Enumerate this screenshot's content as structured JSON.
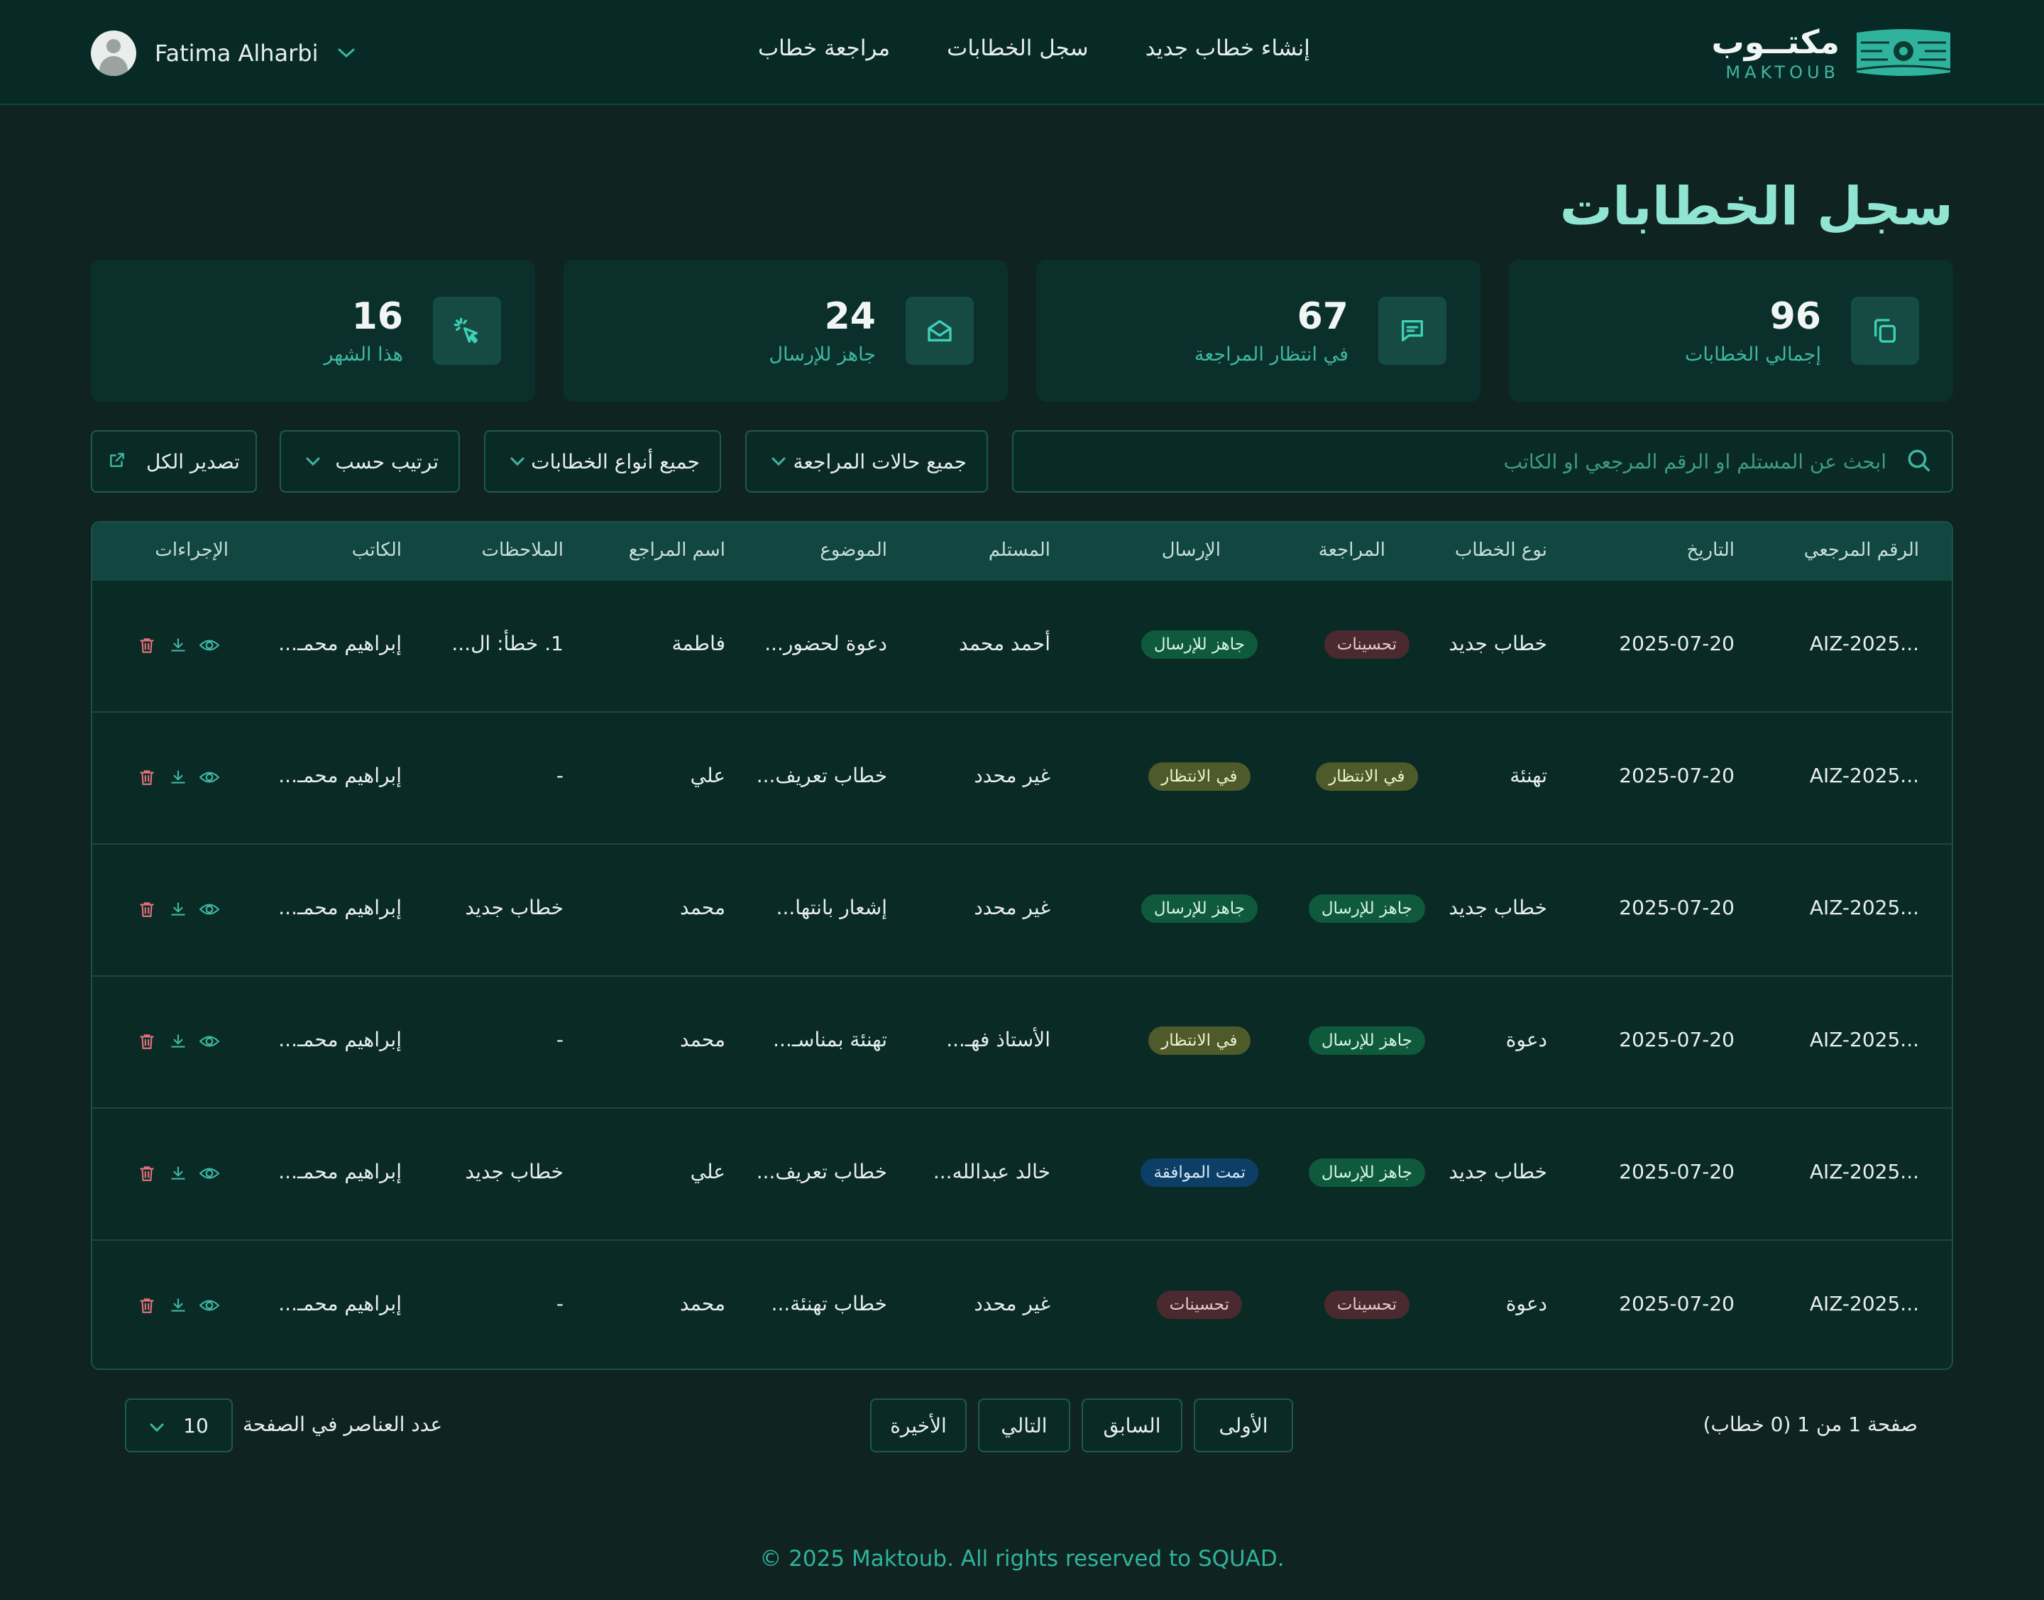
{
  "header": {
    "user_name": "Fatima Alharbi",
    "nav": [
      "إنشاء خطاب جديد",
      "سجل الخطابات",
      "مراجعة خطاب"
    ],
    "logo_ar": "مكتــوب",
    "logo_en": "MAKTOUB"
  },
  "page_title": "سجل الخطابات",
  "stats": [
    {
      "value": "96",
      "label": "إجمالي الخطابات",
      "icon": "copy-icon"
    },
    {
      "value": "67",
      "label": "في انتظار المراجعة",
      "icon": "message-icon"
    },
    {
      "value": "24",
      "label": "جاهز للإرسال",
      "icon": "mail-open-icon"
    },
    {
      "value": "16",
      "label": "هذا الشهر",
      "icon": "click-icon"
    }
  ],
  "filters": {
    "search_placeholder": "ابحث عن المستلم او الرقم المرجعي او الكاتب",
    "review_status": "جميع حالات المراجعة",
    "letter_types": "جميع أنواع الخطابات",
    "sort_by": "ترتيب حسب",
    "export_all": "تصدير الكل"
  },
  "table": {
    "headers": [
      "الرقم المرجعي",
      "التاريخ",
      "نوع الخطاب",
      "المراجعة",
      "الإرسال",
      "المستلم",
      "الموضوع",
      "اسم المراجع",
      "الملاحظات",
      "الكاتب",
      "الإجراءات"
    ],
    "rows": [
      {
        "ref": "AIZ-2025...",
        "date": "2025-07-20",
        "type": "خطاب جديد",
        "review": "تحسينات",
        "send": "جاهز للإرسال",
        "recipient": "أحمد محمد",
        "subject": "دعوة لحضور...",
        "reviewer": "فاطمة",
        "notes": "1. خطأ: ال...",
        "writer": "إبراهيم محمـ..."
      },
      {
        "ref": "AIZ-2025...",
        "date": "2025-07-20",
        "type": "تهنئة",
        "review": "في الانتظار",
        "send": "في الانتظار",
        "recipient": "غير محدد",
        "subject": "خطاب تعريف...",
        "reviewer": "علي",
        "notes": "-",
        "writer": "إبراهيم محمـ..."
      },
      {
        "ref": "AIZ-2025...",
        "date": "2025-07-20",
        "type": "خطاب جديد",
        "review": "جاهز للإرسال",
        "send": "جاهز للإرسال",
        "recipient": "غير محدد",
        "subject": "إشعار بانتها...",
        "reviewer": "محمد",
        "notes": "خطاب جديد",
        "writer": "إبراهيم محمـ..."
      },
      {
        "ref": "AIZ-2025...",
        "date": "2025-07-20",
        "type": "دعوة",
        "review": "جاهز للإرسال",
        "send": "في الانتظار",
        "recipient": "الأستاذ فهـ...",
        "subject": "تهنئة بمناسـ...",
        "reviewer": "محمد",
        "notes": "-",
        "writer": "إبراهيم محمـ..."
      },
      {
        "ref": "AIZ-2025...",
        "date": "2025-07-20",
        "type": "خطاب جديد",
        "review": "جاهز للإرسال",
        "send": "تمت الموافقة",
        "recipient": "خالد عبدالله...",
        "subject": "خطاب تعريف...",
        "reviewer": "علي",
        "notes": "خطاب جديد",
        "writer": "إبراهيم محمـ..."
      },
      {
        "ref": "AIZ-2025...",
        "date": "2025-07-20",
        "type": "دعوة",
        "review": "تحسينات",
        "send": "تحسينات",
        "recipient": "غير محدد",
        "subject": "خطاب تهنئة...",
        "reviewer": "محمد",
        "notes": "-",
        "writer": "إبراهيم محمـ..."
      }
    ]
  },
  "badge_colors": {
    "تحسينات": {
      "bg": "#4a2a2e",
      "fg": "#f0c6c6"
    },
    "جاهز للإرسال": {
      "bg": "#0f5a3d",
      "fg": "#d8f5e6"
    },
    "في الانتظار": {
      "bg": "#4f5a2a",
      "fg": "#ecf1cf"
    },
    "تمت الموافقة": {
      "bg": "#0d3f66",
      "fg": "#d3e8f8"
    }
  },
  "pagination": {
    "info": "صفحة 1 من 1 (0 خطاب)",
    "first": "الأولى",
    "prev": "السابق",
    "next": "التالي",
    "last": "الأخيرة",
    "per_page_label": "عدد العناصر في الصفحة",
    "per_page_value": "10"
  },
  "footer": "© 2025 Maktoub. All rights reserved to SQUAD."
}
